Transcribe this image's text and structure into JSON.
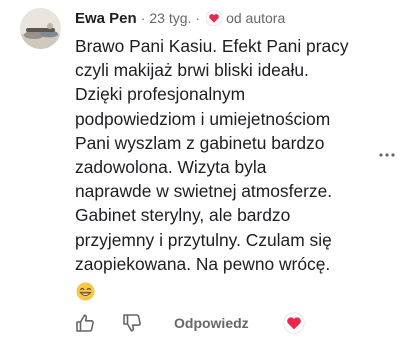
{
  "comment": {
    "author": "Ewa Pen",
    "separator": "·",
    "time_ago": "23 tyg.",
    "author_badge": "od autora",
    "text": "Brawo Pani Kasiu. Efekt Pani pracy\nczyli makijaż brwi bliski ideału.\nDzięki profesjonalnym\npodpowiedziom i umiejetnościom\nPani wyszlam z gabinetu bardzo\nzadowolona. Wizyta byla\nnaprawde w swietnej atmosferze.\nGabinet sterylny, ale bardzo\nprzyjemny i przytulny. Czulam się\nzaopiekowana. Na pewno wrócę."
  },
  "actions": {
    "reply_label": "Odpowiedz"
  },
  "icons": {
    "avatar": "profile-photo",
    "heart_badge": "heart-icon",
    "emoji": "grinning-face-emoji",
    "more": "more-options-icon",
    "like": "thumbs-up-icon",
    "dislike": "thumbs-down-icon",
    "love": "heart-icon"
  },
  "colors": {
    "text": "#1c1e21",
    "secondary": "#65676b",
    "heart": "#e8294c"
  }
}
